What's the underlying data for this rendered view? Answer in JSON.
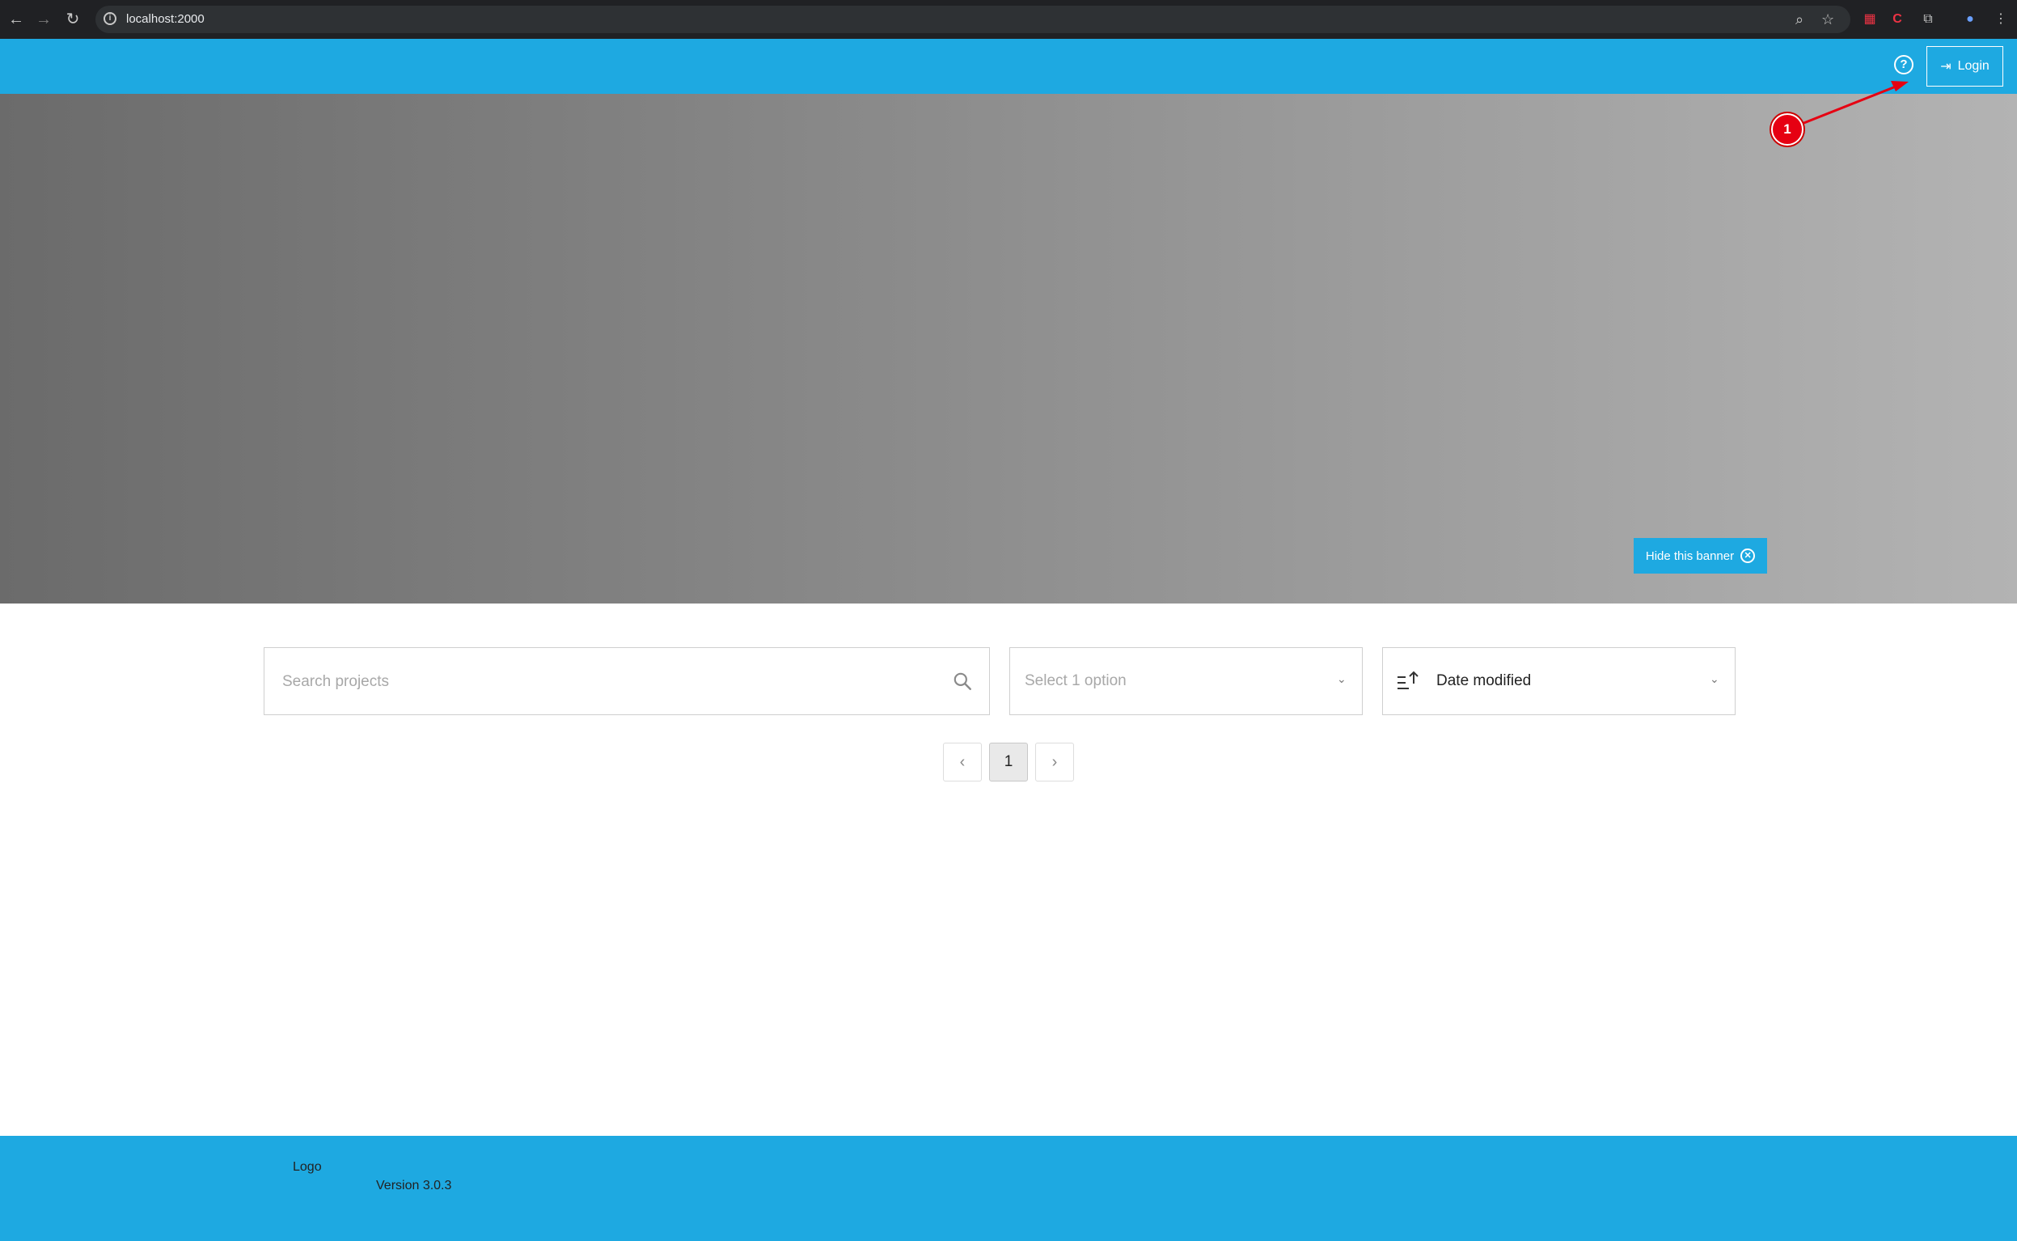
{
  "browser": {
    "url": "localhost:2000",
    "icons": {
      "back": "back-arrow-icon",
      "forward": "forward-arrow-icon",
      "reload": "reload-icon",
      "info": "site-info-icon",
      "zoom": "zoom-icon",
      "bookmark": "star-icon",
      "extensions": "puzzle-icon",
      "menu": "kebab-menu-icon"
    }
  },
  "header": {
    "help_icon": "?",
    "login_label": "Login",
    "color": "#1ea9e1"
  },
  "banner": {
    "hide_label": "Hide this banner"
  },
  "annotation": {
    "badge": "1",
    "color": "#e60012"
  },
  "filters": {
    "search_placeholder": "Search projects",
    "select_placeholder": "Select 1 option",
    "sort_label": "Date modified"
  },
  "pagination": {
    "prev": "‹",
    "current": "1",
    "next": "›"
  },
  "footer": {
    "logo_alt": "Logo",
    "version": "Version 3.0.3"
  }
}
